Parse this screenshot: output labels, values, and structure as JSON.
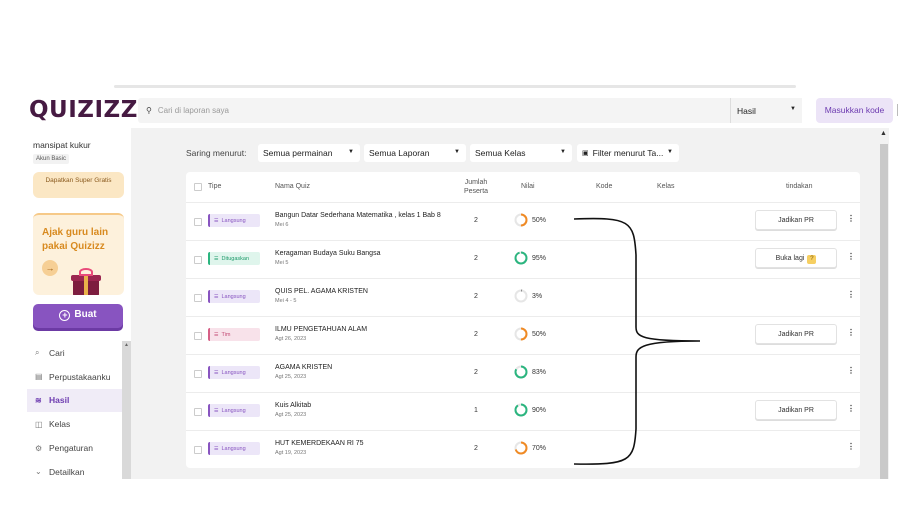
{
  "app": {
    "logo": "QUIZIZZ",
    "user_name": "mansipat kukur",
    "account_type": "Akun Basic",
    "upgrade_label": "Dapatkan Super Gratis",
    "invite_text": "Ajak guru lain pakai Quizizz",
    "create_label": "Buat"
  },
  "sidebar": {
    "items": [
      {
        "label": "Cari",
        "icon": "search-icon",
        "active": false
      },
      {
        "label": "Perpustakaanku",
        "icon": "library-icon",
        "active": false
      },
      {
        "label": "Hasil",
        "icon": "results-icon",
        "active": true
      },
      {
        "label": "Kelas",
        "icon": "classes-icon",
        "active": false
      },
      {
        "label": "Pengaturan",
        "icon": "settings-icon",
        "active": false
      },
      {
        "label": "Detailkan",
        "icon": "chevron-down-icon",
        "active": false
      }
    ]
  },
  "topbar": {
    "search_placeholder": "Cari di laporan saya",
    "scope_value": "Hasil",
    "enter_code_label": "Masukkan kode"
  },
  "filters": {
    "label": "Saring menurut:",
    "game": "Semua permainan",
    "report": "Semua Laporan",
    "class": "Semua Kelas",
    "date": "Filter menurut Ta..."
  },
  "table": {
    "headers": {
      "type": "Tipe",
      "name": "Nama Quiz",
      "participants_1": "Jumlah",
      "participants_2": "Peserta",
      "score": "Nilai",
      "code": "Kode",
      "class": "Kelas",
      "action": "tindakan"
    },
    "rows": [
      {
        "type": "Langsung",
        "kind": "live",
        "name": "Bangun Datar Sederhana Matematika , kelas 1 Bab 8",
        "date": "Mei 6",
        "participants": "2",
        "score": "50%",
        "score_value": 0.5,
        "score_color": "#f08a24",
        "action": "Jadikan PR",
        "action_help": false
      },
      {
        "type": "Ditugaskan",
        "kind": "assign",
        "name": "Keragaman Budaya Suku Bangsa",
        "date": "Mei 5",
        "participants": "2",
        "score": "95%",
        "score_value": 0.95,
        "score_color": "#2bb57f",
        "action": "Buka lagi",
        "action_help": true
      },
      {
        "type": "Langsung",
        "kind": "live",
        "name": "QUIS PEL. AGAMA KRISTEN",
        "date": "Mei 4 - 5",
        "participants": "2",
        "score": "3%",
        "score_value": 0.03,
        "score_color": "#8a8a8a",
        "action": "",
        "action_help": false
      },
      {
        "type": "Tim",
        "kind": "team",
        "name": "ILMU PENGETAHUAN ALAM",
        "date": "Agt 26, 2023",
        "participants": "2",
        "score": "50%",
        "score_value": 0.5,
        "score_color": "#f08a24",
        "action": "Jadikan PR",
        "action_help": false
      },
      {
        "type": "Langsung",
        "kind": "live",
        "name": "AGAMA KRISTEN",
        "date": "Agt 25, 2023",
        "participants": "2",
        "score": "83%",
        "score_value": 0.83,
        "score_color": "#2bb57f",
        "action": "",
        "action_help": false
      },
      {
        "type": "Langsung",
        "kind": "live",
        "name": "Kuis Alkitab",
        "date": "Agt 25, 2023",
        "participants": "1",
        "score": "90%",
        "score_value": 0.9,
        "score_color": "#2bb57f",
        "action": "Jadikan PR",
        "action_help": false
      },
      {
        "type": "Langsung",
        "kind": "live",
        "name": "HUT KEMERDEKAAN RI 75",
        "date": "Agt 19, 2023",
        "participants": "2",
        "score": "70%",
        "score_value": 0.7,
        "score_color": "#f08a24",
        "action": "",
        "action_help": false
      }
    ]
  },
  "colors": {
    "brand": "#461a42",
    "accent": "#8854c0",
    "success": "#2bb57f",
    "warning": "#f08a24"
  }
}
